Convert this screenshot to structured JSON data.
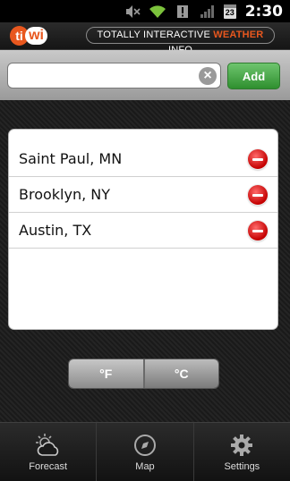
{
  "status": {
    "time": "2:30",
    "calendar_day": "23"
  },
  "header": {
    "logo_text": "ti",
    "logo_suffix": "wi",
    "tagline_pre": "TOTALLY INTERACTIVE ",
    "tagline_accent": "WEATHER",
    "tagline_post": " INFO",
    "accent_color": "#e8571e"
  },
  "search": {
    "value": "",
    "placeholder": "",
    "clear_icon": "clear-icon"
  },
  "add_button": {
    "label": "Add"
  },
  "locations": [
    {
      "name": "Saint Paul, MN"
    },
    {
      "name": "Brooklyn, NY"
    },
    {
      "name": "Austin, TX"
    }
  ],
  "units": {
    "fahrenheit": "°F",
    "celsius": "°C",
    "selected": "°C"
  },
  "nav": [
    {
      "label": "Forecast",
      "icon": "forecast-icon"
    },
    {
      "label": "Map",
      "icon": "compass-icon"
    },
    {
      "label": "Settings",
      "icon": "gear-icon"
    }
  ]
}
